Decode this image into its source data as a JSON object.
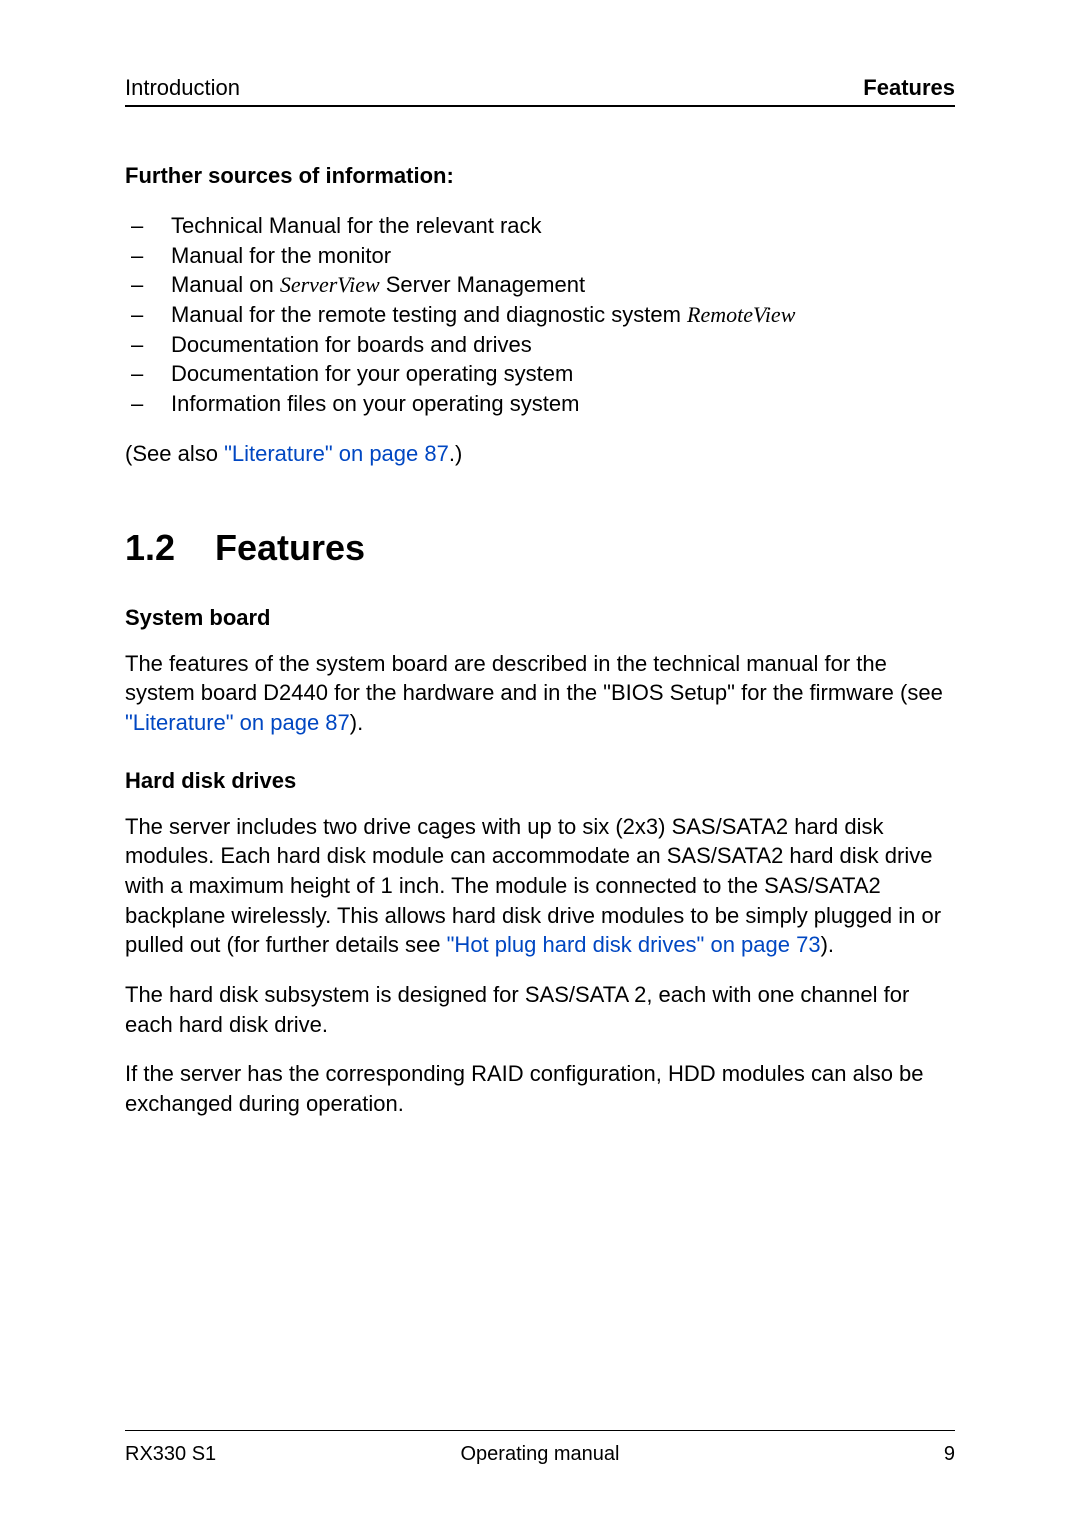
{
  "header": {
    "left": "Introduction",
    "right": "Features"
  },
  "further_sources": {
    "title": "Further sources of information:",
    "items": [
      {
        "text": "Technical Manual for the relevant rack"
      },
      {
        "text": "Manual for the monitor"
      },
      {
        "pre": "Manual on ",
        "italic": "ServerView",
        "post": " Server Management"
      },
      {
        "pre": "Manual for the remote testing and diagnostic system ",
        "italic": "RemoteView",
        "post": ""
      },
      {
        "text": "Documentation for boards and drives"
      },
      {
        "text": "Documentation for your operating system"
      },
      {
        "text": "Information files on your operating system"
      }
    ],
    "see_also_pre": "(See also ",
    "see_also_link": "\"Literature\" on page 87",
    "see_also_post": ".)"
  },
  "section": {
    "number": "1.2",
    "title": "Features"
  },
  "system_board": {
    "title": "System board",
    "para_pre": "The features of the system board are described in the technical manual for the system board D2440 for the hardware and in the \"BIOS Setup\" for the firmware (see ",
    "para_link": "\"Literature\" on page 87",
    "para_post": ")."
  },
  "hdd": {
    "title": "Hard disk drives",
    "p1_pre": "The server includes two drive cages with up to six (2x3) SAS/SATA2 hard disk modules. Each hard disk module can accommodate an SAS/SATA2 hard disk drive with a maximum height of 1 inch. The module is connected to the SAS/SATA2 backplane wirelessly. This allows hard disk drive modules to be simply plugged in or pulled out (for further details see ",
    "p1_link": "\"Hot plug hard disk drives\" on page 73",
    "p1_post": ").",
    "p2": "The hard disk subsystem is designed for SAS/SATA 2, each with one channel for each hard disk drive.",
    "p3": "If the server has the corresponding RAID configuration, HDD modules can also be exchanged during operation."
  },
  "footer": {
    "left": "RX330 S1",
    "center": "Operating manual",
    "right": "9"
  }
}
